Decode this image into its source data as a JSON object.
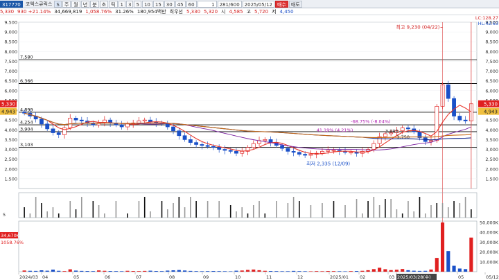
{
  "toolbar": {
    "code": "317770",
    "name": "코엑스큐릭스",
    "badge": "S",
    "periods": [
      "주",
      "월",
      "년",
      "분",
      "초",
      "틱"
    ],
    "intervals": [
      "1",
      "3",
      "5",
      "10",
      "15",
      "30",
      "45",
      "60"
    ],
    "interval_field": "1",
    "count_field": "281/600",
    "date": "2025/05/12",
    "buy_label": "매수",
    "sell_label": "매도"
  },
  "info": {
    "price": "5,330",
    "change": "930 +21.14%",
    "volume": "34,669,819",
    "volume_ratio": "1,058.76%",
    "turnover": "31.26%",
    "amount": "180,954백만",
    "pref_label": "최우선",
    "pref_ask": "5,330",
    "pref_bid": "5,320",
    "open_label": "시",
    "open": "4,585",
    "high_label": "고",
    "high": "5,720",
    "low_label": "저",
    "low": "4,450"
  },
  "chart_data": [
    {
      "type": "candlestick",
      "title": "",
      "x_labels": [
        "2024/03",
        "04",
        "05",
        "06",
        "07",
        "08",
        "09",
        "10",
        "11",
        "12",
        "2025/01",
        "02",
        "03",
        "2025/03/28(수)",
        "05",
        "05/12"
      ],
      "ylim": [
        1000,
        9500
      ],
      "y_ticks": [
        "9,500",
        "9,000",
        "8,500",
        "8,000",
        "7,500",
        "7,000",
        "6,500",
        "6,000",
        "5,500",
        "5,000",
        "4,500",
        "4,000",
        "3,500",
        "3,000",
        "2,500",
        "2,000",
        "1,500"
      ],
      "horizontal_levels": [
        {
          "label": "7,580",
          "value": 7580
        },
        {
          "label": "6,366",
          "value": 6366
        },
        {
          "label": "4,899",
          "value": 4899
        },
        {
          "label": "4,254",
          "value": 4254
        },
        {
          "label": "3,904",
          "value": 3904
        },
        {
          "label": "3,103",
          "value": 3103
        }
      ],
      "annotations": [
        {
          "text": "최고 9,230 (04/22)",
          "value": 9230
        },
        {
          "text": "최저 2,335 (12/09)",
          "value": 2335
        },
        {
          "text": "-68.75% (-8.04%)"
        },
        {
          "text": "41.19% (4.21%)"
        },
        {
          "text": "3,888"
        },
        {
          "text": "3,750"
        }
      ],
      "right_labels": [
        "LC:128.27",
        "HL:42.63"
      ],
      "price_tags": [
        {
          "text": "5,330",
          "color": "#e02020"
        },
        {
          "text": "4,943",
          "color": "#f0c040"
        }
      ],
      "close_series": [
        4850,
        4700,
        4550,
        4300,
        4050,
        3850,
        3750,
        4100,
        4600,
        4500,
        4450,
        4350,
        4250,
        4350,
        4500,
        4350,
        4250,
        4150,
        4300,
        4350,
        4450,
        4500,
        4400,
        4350,
        4300,
        4150,
        3950,
        3700,
        3500,
        3350,
        3250,
        3200,
        3150,
        3100,
        3000,
        2950,
        2900,
        2800,
        2900,
        3100,
        3300,
        3450,
        3500,
        3350,
        3200,
        3050,
        2900,
        2850,
        2750,
        2700,
        2750,
        2800,
        2900,
        2950,
        2950,
        2900,
        2850,
        2850,
        2800,
        2900,
        3000,
        3300,
        3650,
        3800,
        3850,
        3950,
        4100,
        4050,
        3900,
        3600,
        3400,
        3450,
        5200,
        6300,
        5600,
        4700,
        4500,
        4450,
        5330
      ]
    },
    {
      "type": "bar",
      "title": "",
      "ylabel": "",
      "y_ticks": [
        "50,000K",
        "40,000K",
        "30,000K",
        "20,000K",
        "10,000K"
      ],
      "ylim": [
        0,
        50000
      ],
      "right_tags": [
        {
          "text": "34,670K",
          "color": "#e02020"
        },
        {
          "text": "1058.76%",
          "color": "#e02020"
        }
      ],
      "values": [
        1200,
        900,
        800,
        1400,
        1000,
        2100,
        900,
        600,
        2400,
        1100,
        800,
        700,
        600,
        1300,
        900,
        700,
        600,
        500,
        900,
        700,
        600,
        800,
        1000,
        700,
        600,
        1100,
        1400,
        1700,
        1200,
        800,
        600,
        500,
        600,
        700,
        600,
        500,
        400,
        1000,
        1200,
        1800,
        2200,
        1500,
        900,
        700,
        600,
        500,
        500,
        800,
        600,
        500,
        400,
        600,
        500,
        700,
        600,
        500,
        400,
        600,
        700,
        900,
        1500,
        2600,
        4000,
        2500,
        1600,
        2000,
        2700,
        1500,
        1000,
        800,
        900,
        2200,
        14000,
        50000,
        21000,
        6000,
        3200,
        2600,
        34670
      ]
    }
  ]
}
